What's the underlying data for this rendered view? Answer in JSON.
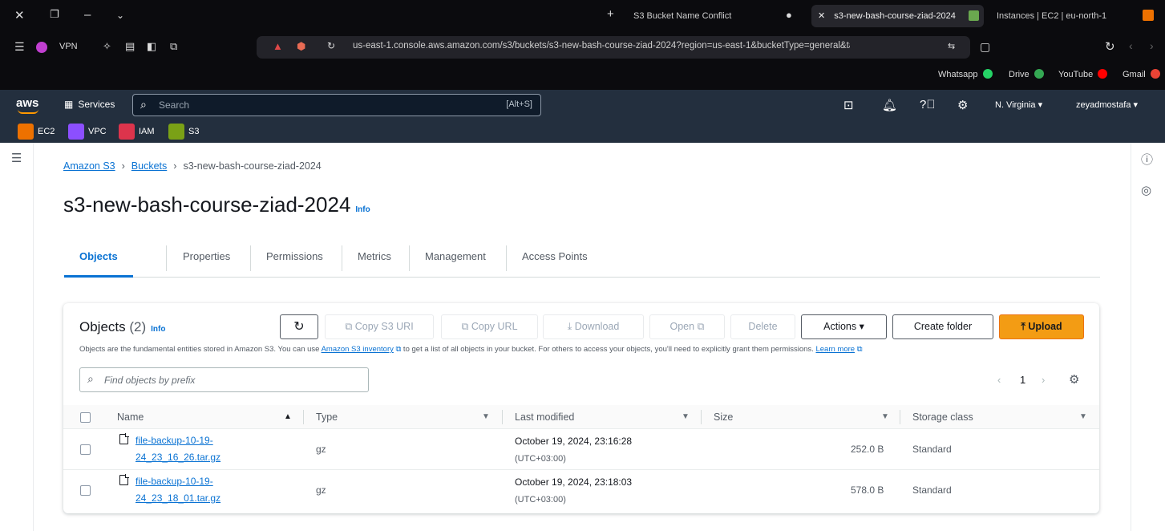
{
  "browser": {
    "tabs": [
      {
        "label": "S3 Bucket Name Conflict",
        "active": false
      },
      {
        "label": "s3-new-bash-course-ziad-2024",
        "active": true
      },
      {
        "label": "Instances | EC2 | eu-north-1",
        "active": false
      }
    ],
    "vpn_label": "VPN",
    "url": "us-east-1.console.aws.amazon.com/s3/buckets/s3-new-bash-course-ziad-2024?region=us-east-1&bucketType=general&ta...",
    "bookmarks": [
      {
        "label": "Whatsapp",
        "color": "#25d366"
      },
      {
        "label": "Drive",
        "color": "#34a853"
      },
      {
        "label": "YouTube",
        "color": "#ff0000"
      },
      {
        "label": "Gmail",
        "color": "#ea4335"
      }
    ]
  },
  "aws_header": {
    "logo": "aws",
    "services_label": "Services",
    "search_placeholder": "Search",
    "search_shortcut": "[Alt+S]",
    "region": "N. Virginia",
    "user": "zeyadmostafa",
    "favorites": [
      {
        "label": "EC2",
        "color": "#ed7100"
      },
      {
        "label": "VPC",
        "color": "#8c4fff"
      },
      {
        "label": "IAM",
        "color": "#dd344c"
      },
      {
        "label": "S3",
        "color": "#7aa116"
      }
    ]
  },
  "breadcrumb": {
    "items": [
      "Amazon S3",
      "Buckets",
      "s3-new-bash-course-ziad-2024"
    ]
  },
  "page": {
    "title": "s3-new-bash-course-ziad-2024",
    "info_label": "Info"
  },
  "tabs": [
    "Objects",
    "Properties",
    "Permissions",
    "Metrics",
    "Management",
    "Access Points"
  ],
  "objects_panel": {
    "title": "Objects",
    "count": "(2)",
    "info_label": "Info",
    "buttons": {
      "refresh": "↻",
      "copy_s3_uri": "Copy S3 URI",
      "copy_url": "Copy URL",
      "download": "Download",
      "open": "Open",
      "delete": "Delete",
      "actions": "Actions",
      "create_folder": "Create folder",
      "upload": "Upload"
    },
    "description_1": "Objects are the fundamental entities stored in Amazon S3. You can use ",
    "description_link": "Amazon S3 inventory",
    "description_2": " to get a list of all objects in your bucket. For others to access your objects, you'll need to explicitly grant them permissions. ",
    "description_learn": "Learn more",
    "filter_placeholder": "Find objects by prefix",
    "page_number": "1",
    "columns": [
      "Name",
      "Type",
      "Last modified",
      "Size",
      "Storage class"
    ],
    "rows": [
      {
        "name_line1": "file-backup-10-19-",
        "name_line2": "24_23_16_26.tar.gz",
        "type": "gz",
        "last_modified": "October 19, 2024, 23:16:28",
        "timezone": "(UTC+03:00)",
        "size": "252.0 B",
        "storage_class": "Standard"
      },
      {
        "name_line1": "file-backup-10-19-",
        "name_line2": "24_23_18_01.tar.gz",
        "type": "gz",
        "last_modified": "October 19, 2024, 23:18:03",
        "timezone": "(UTC+03:00)",
        "size": "578.0 B",
        "storage_class": "Standard"
      }
    ]
  }
}
